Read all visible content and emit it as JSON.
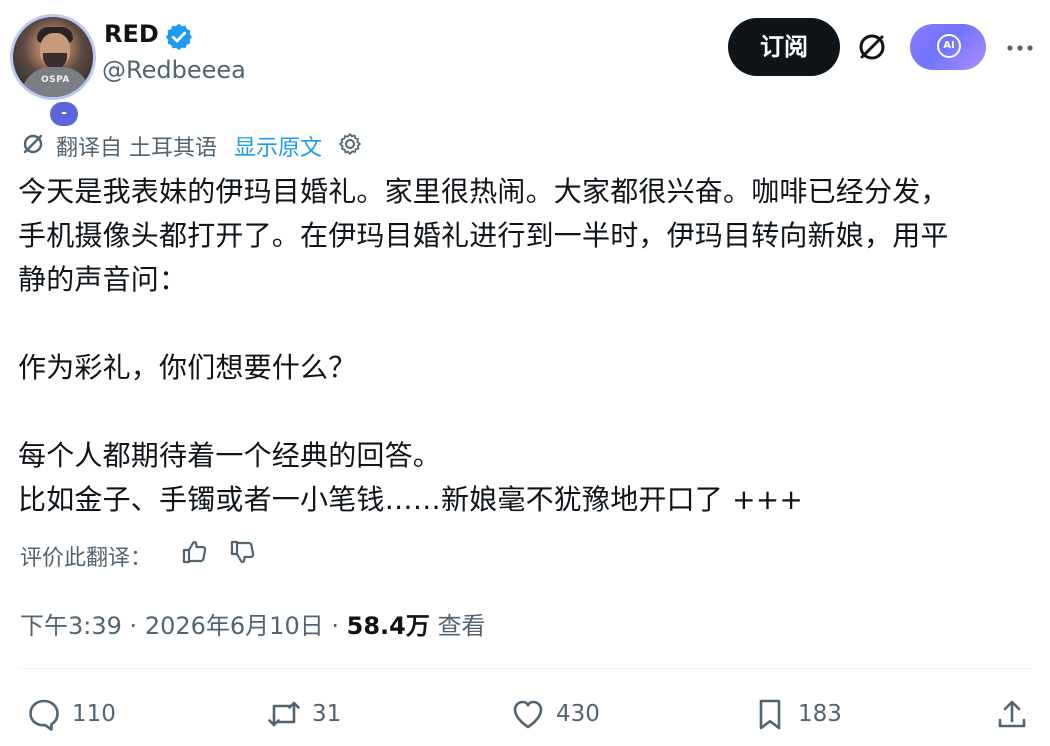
{
  "author": {
    "display_name": "RED",
    "handle": "@Redbeeea",
    "avatar_badge": "-",
    "avatar_shirt_text": "OSPA"
  },
  "header_actions": {
    "subscribe_label": "订阅",
    "translate_icon": "translate-slash-icon",
    "ai_label": "AI",
    "more_icon": "more-horizontal-icon"
  },
  "translation": {
    "label": "翻译自 土耳其语",
    "show_original": "显示原文"
  },
  "post": {
    "lines": [
      "今天是我表妹的伊玛目婚礼。家里很热闹。大家都很兴奋。咖啡已经分发，",
      "手机摄像头都打开了。在伊玛目婚礼进行到一半时，伊玛目转向新娘，用平",
      "静的声音问："
    ],
    "question": "作为彩礼，你们想要什么？",
    "closing_lines": [
      "每个人都期待着一个经典的回答。",
      "比如金子、手镯或者一小笔钱……新娘毫不犹豫地开口了 +++"
    ]
  },
  "rate_translation": {
    "label": "评价此翻译："
  },
  "meta": {
    "time": "下午3:39",
    "separator": "·",
    "date": "2026年6月10日",
    "views_count": "58.4万",
    "views_label": "查看"
  },
  "actions": {
    "reply_count": "110",
    "retweet_count": "31",
    "like_count": "430",
    "bookmark_count": "183"
  },
  "colors": {
    "text_primary": "#0f1419",
    "text_secondary": "#536471",
    "link_blue": "#1d9bf0",
    "verified_blue": "#1d9bf0",
    "subscribe_bg": "#0f1419",
    "ai_gradient_start": "#8c7bff",
    "ai_gradient_end": "#b28cff"
  }
}
